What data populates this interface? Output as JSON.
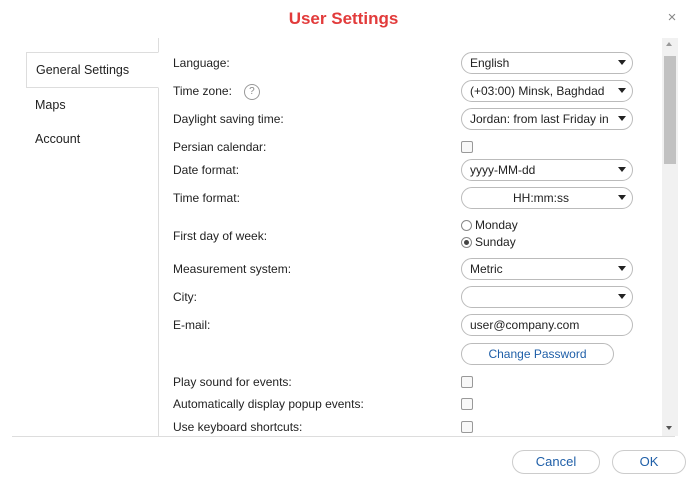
{
  "dialog": {
    "title": "User Settings",
    "close": "×"
  },
  "sidebar": {
    "items": [
      {
        "label": "General Settings"
      },
      {
        "label": "Maps"
      },
      {
        "label": "Account"
      }
    ]
  },
  "settings": {
    "language": {
      "label": "Language:",
      "value": "English"
    },
    "time_zone": {
      "label": "Time zone:",
      "value": "(+03:00) Minsk, Baghdad",
      "help": "?"
    },
    "dst": {
      "label": "Daylight saving time:",
      "value": "Jordan: from last Friday in"
    },
    "persian": {
      "label": "Persian calendar:"
    },
    "date_format": {
      "label": "Date format:",
      "value": "yyyy-MM-dd"
    },
    "time_format": {
      "label": "Time format:",
      "value": "HH:mm:ss"
    },
    "first_day": {
      "label": "First day of week:",
      "options": [
        "Monday",
        "Sunday"
      ]
    },
    "measurement": {
      "label": "Measurement system:",
      "value": "Metric"
    },
    "city": {
      "label": "City:",
      "value": ""
    },
    "email": {
      "label": "E-mail:",
      "value": "user@company.com"
    },
    "change_password": "Change Password",
    "play_sound": {
      "label": "Play sound for events:"
    },
    "popup": {
      "label": "Automatically display popup events:"
    },
    "shortcuts": {
      "label": "Use keyboard shortcuts:"
    }
  },
  "footer": {
    "cancel": "Cancel",
    "ok": "OK"
  }
}
